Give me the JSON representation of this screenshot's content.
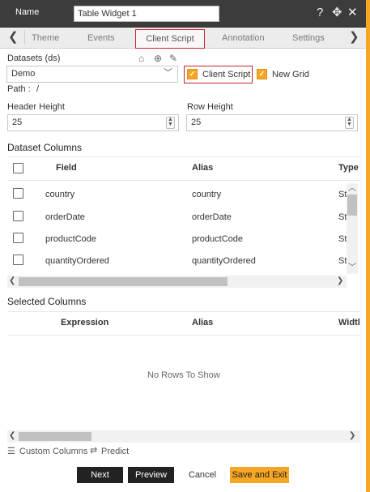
{
  "header": {
    "name_label": "Name",
    "name_value": "Table Widget 1",
    "help_icon": "question-mark-icon",
    "move_icon": "move-arrows-icon",
    "close_icon": "close-icon"
  },
  "tabs": {
    "items": [
      "Theme",
      "Events",
      "Client Script",
      "Annotation",
      "Settings"
    ],
    "active": "Client Script"
  },
  "datasets": {
    "label": "Datasets (ds)",
    "selected": "Demo",
    "path_label": "Path :",
    "path_value": "/",
    "client_script_label": "Client Script",
    "client_script_checked": true,
    "new_grid_label": "New Grid",
    "new_grid_checked": true,
    "icons": [
      "home-icon",
      "add-circle-icon",
      "edit-icon"
    ]
  },
  "dimensions": {
    "header_height_label": "Header Height",
    "header_height_value": "25",
    "row_height_label": "Row Height",
    "row_height_value": "25"
  },
  "dataset_columns": {
    "title": "Dataset Columns",
    "headers": [
      "Field",
      "Alias",
      "Type"
    ],
    "rows": [
      {
        "field": "country",
        "alias": "country",
        "type": "St"
      },
      {
        "field": "orderDate",
        "alias": "orderDate",
        "type": "St"
      },
      {
        "field": "productCode",
        "alias": "productCode",
        "type": "St"
      },
      {
        "field": "quantityOrdered",
        "alias": "quantityOrdered",
        "type": "St"
      }
    ]
  },
  "selected_columns": {
    "title": "Selected Columns",
    "headers": [
      "Expression",
      "Alias",
      "Widtl"
    ],
    "empty_text": "No Rows To Show"
  },
  "footer_links": {
    "custom_columns": "Custom Columns",
    "predict": "Predict"
  },
  "buttons": {
    "next": "Next",
    "preview": "Preview",
    "cancel": "Cancel",
    "save_exit": "Save and Exit"
  },
  "colors": {
    "accent_orange": "#f5a623",
    "header_bg": "#3c3c3c",
    "highlight_red": "#c8242b"
  }
}
